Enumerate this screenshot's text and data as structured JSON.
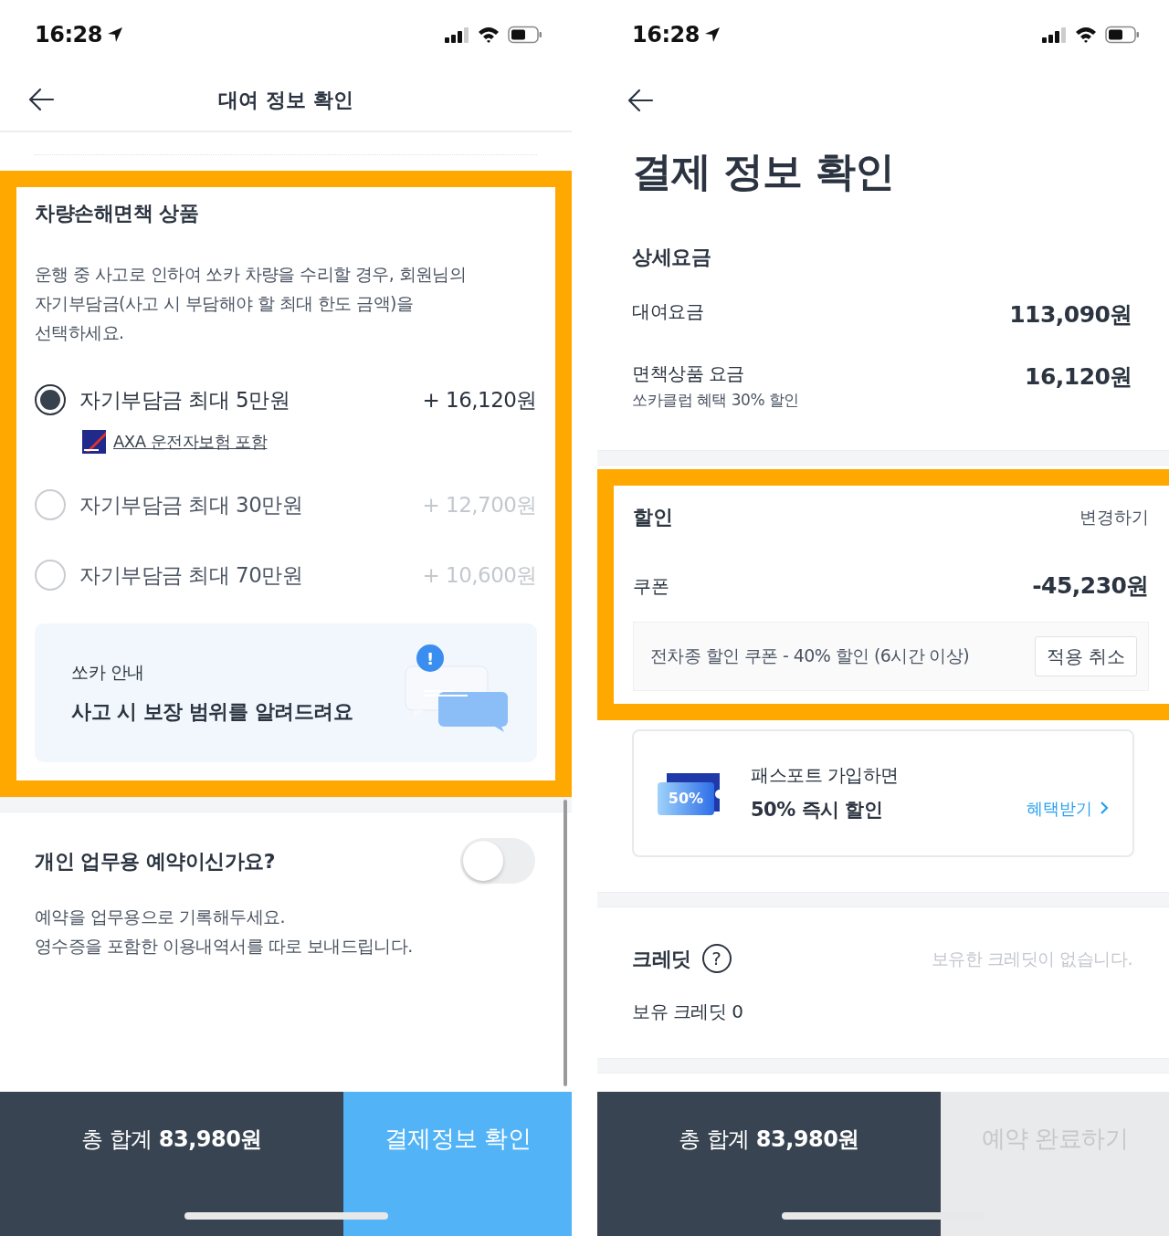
{
  "rental_screen": {
    "status_bar": {
      "time": "16:28"
    },
    "header": {
      "title": "대여 정보 확인"
    },
    "insurance": {
      "highlighted": true,
      "title": "차량손해면책 상품",
      "description": [
        "운행 중 사고로 인하여 쏘카 차량을 수리할 경우, 회원님의",
        "자기부담금(사고 시 부담해야 할 최대 한도 금액)을",
        "선택하세요."
      ],
      "options": [
        {
          "label": "자기부담금 최대 5만원",
          "price": "+ 16,120원",
          "selected": true,
          "note": "AXA 운전자보험 포함"
        },
        {
          "label": "자기부담금 최대 30만원",
          "price": "+ 12,700원",
          "selected": false
        },
        {
          "label": "자기부담금 최대 70만원",
          "price": "+ 10,600원",
          "selected": false
        }
      ],
      "info_card": {
        "caption": "쏘카 안내",
        "title": "사고 시 보장 범위를 알려드려요",
        "badge": "!"
      }
    },
    "business": {
      "title": "개인 업무용 예약이신가요?",
      "on": false,
      "description": [
        "예약을 업무용으로 기록해두세요.",
        "영수증을 포함한 이용내역서를 따로 보내드립니다."
      ]
    },
    "bottom_bar": {
      "total": "총 합계 **83,980원**",
      "action": "결제정보 확인",
      "disabled": false
    }
  },
  "payment_screen": {
    "status_bar": {
      "time": "16:28"
    },
    "title": "결제 정보 확인",
    "details": {
      "title": "상세요금",
      "rows": [
        {
          "label": "대여요금",
          "amount": "113,090원"
        },
        {
          "label": "면책상품 요금",
          "sub": "쏘카클럽 혜택 30% 할인",
          "amount": "16,120원"
        }
      ]
    },
    "discount": {
      "highlighted": true,
      "title": "할인",
      "change": "변경하기",
      "coupon_label": "쿠폰",
      "coupon_amount": "-45,230원",
      "coupon_name": "전차종 할인 쿠폰 - 40% 할인 (6시간 이상)",
      "cancel": "적용 취소"
    },
    "pass_card": {
      "ticket": "50%",
      "caption": "패스포트 가입하면",
      "title": "50% 즉시 할인",
      "link": "혜택받기"
    },
    "credit": {
      "title": "크레딧",
      "help": "?",
      "empty_note": "보유한 크레딧이 없습니다.",
      "balance": "보유 크레딧 0"
    },
    "bottom_bar": {
      "total": "총 합계 **83,980원**",
      "action": "예약 완료하기",
      "disabled": true
    }
  }
}
